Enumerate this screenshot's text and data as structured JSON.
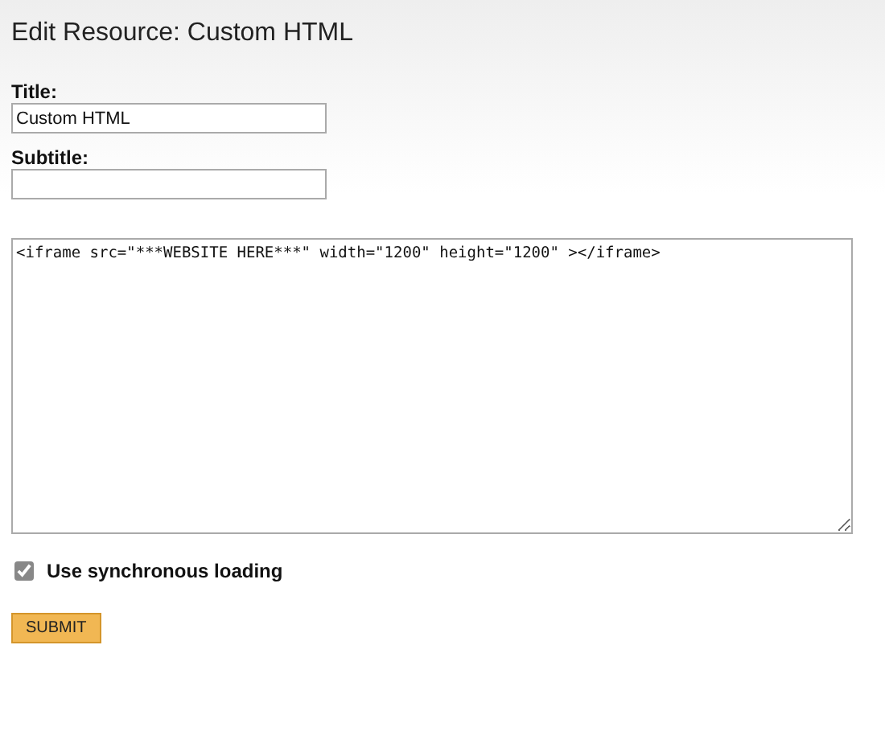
{
  "heading": "Edit Resource: Custom HTML",
  "fields": [
    {
      "label": "Title:",
      "value": "Custom HTML"
    },
    {
      "label": "Subtitle:"
    }
  ],
  "code_area": {
    "value": "<iframe src=\"***WEBSITE HERE***\" width=\"1200\" height=\"1200\" ></iframe>"
  },
  "sync_loading": {
    "label": "Use synchronous loading",
    "checked": true
  },
  "submit": {
    "label": "SUBMIT"
  }
}
